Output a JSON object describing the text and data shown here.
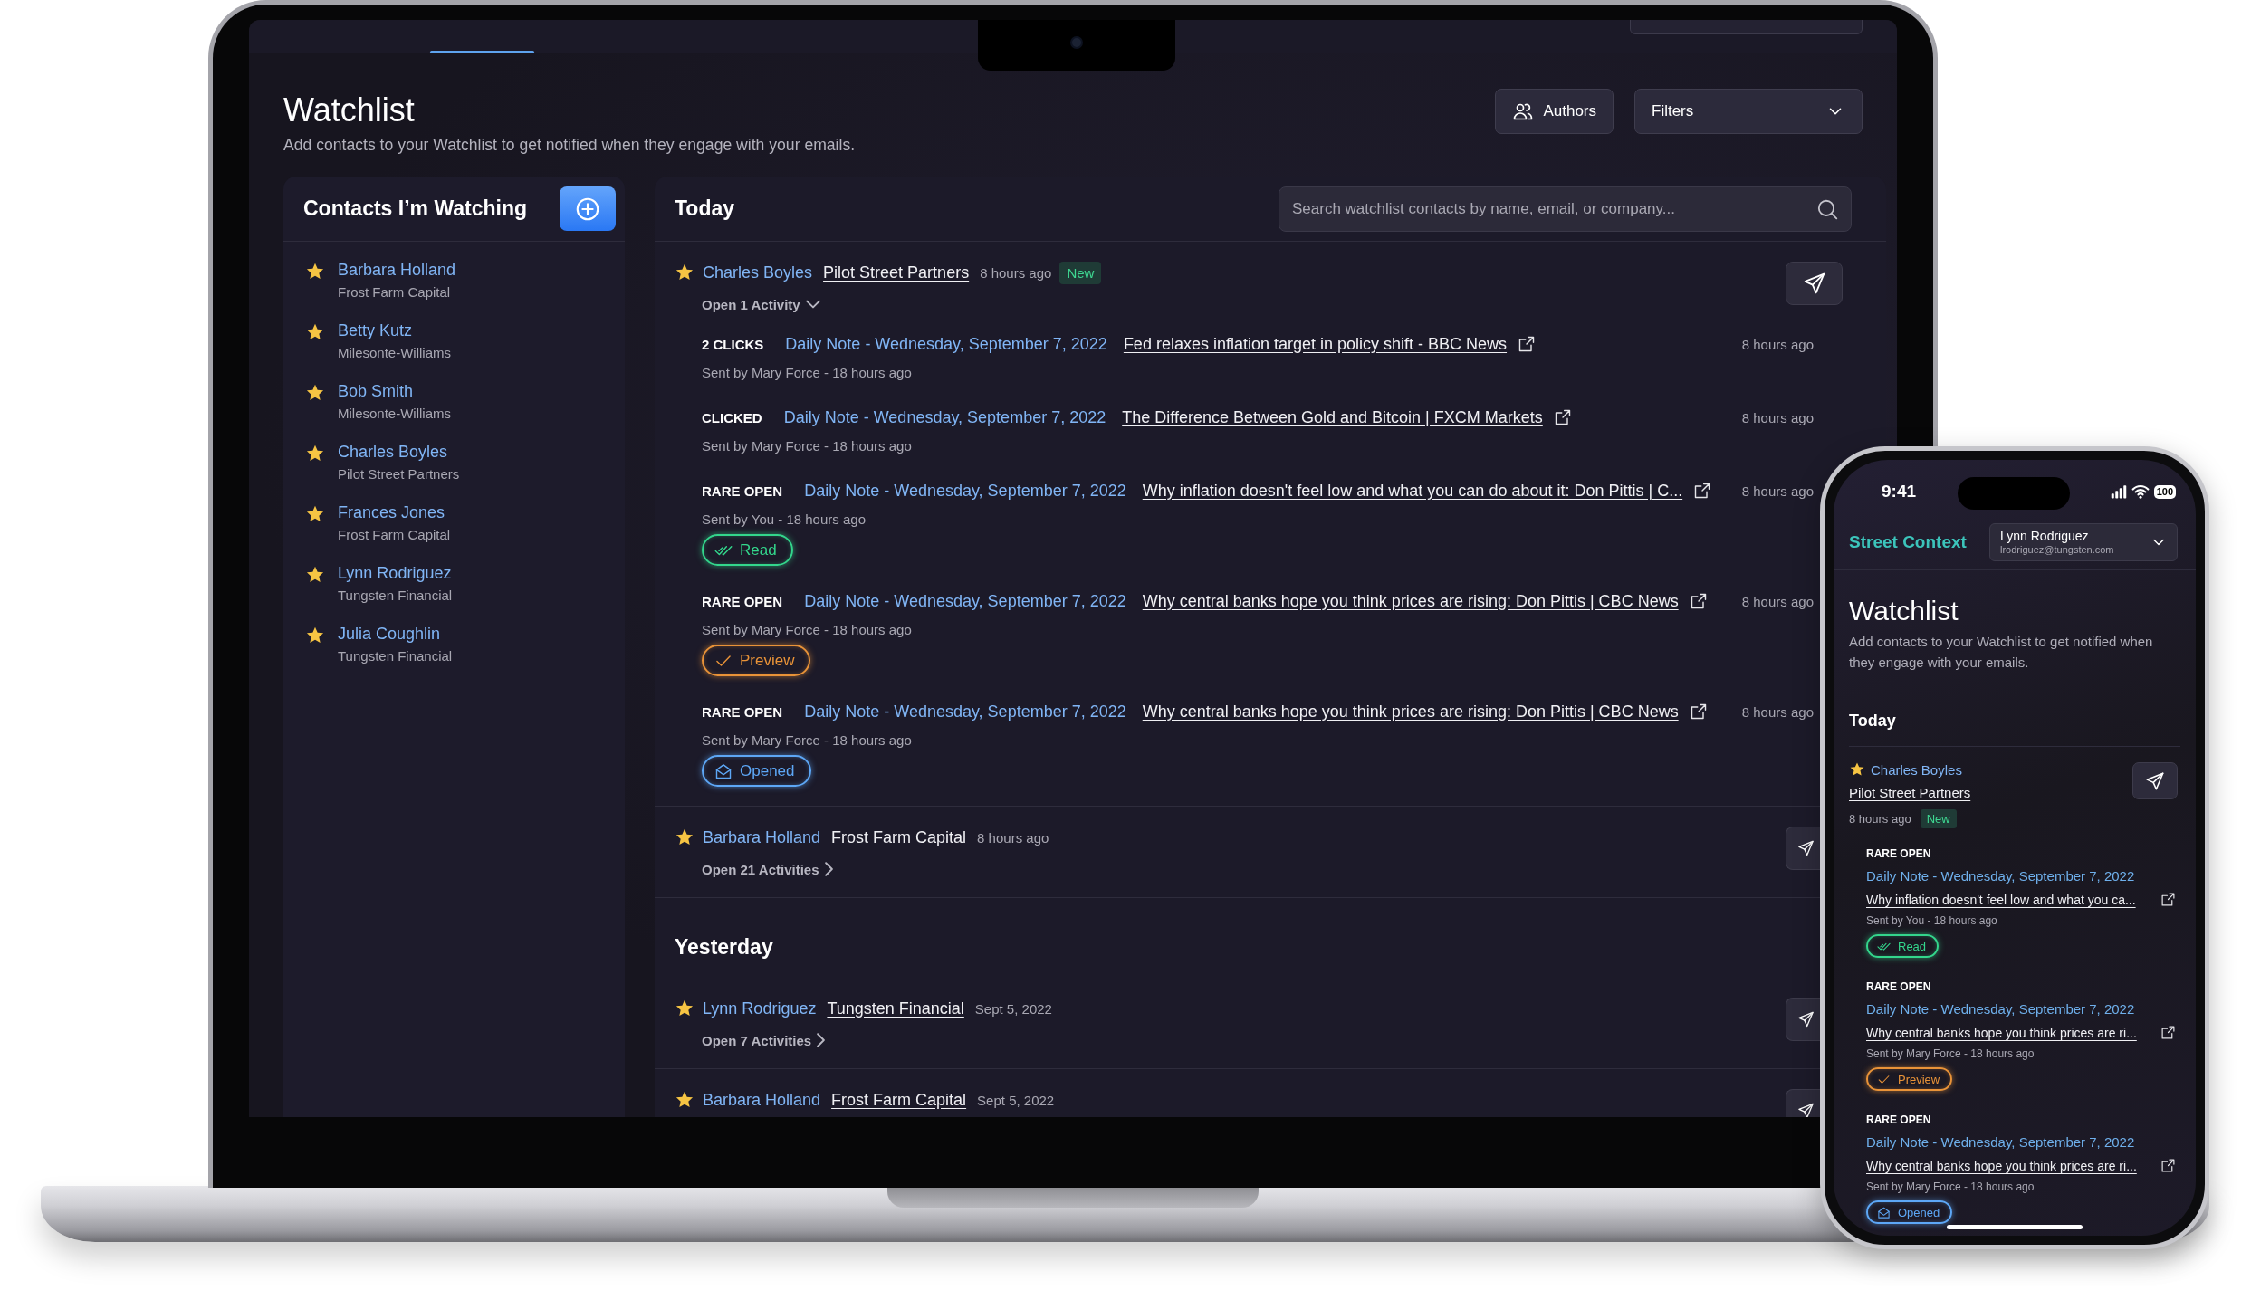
{
  "laptop": {
    "page": {
      "title": "Watchlist",
      "subtitle": "Add contacts to your Watchlist to get notified when they engage with your emails."
    },
    "actions": {
      "authors": "Authors",
      "filters": "Filters"
    },
    "sidebar": {
      "title": "Contacts I’m Watching",
      "contacts": [
        {
          "name": "Barbara Holland",
          "company": "Frost Farm Capital"
        },
        {
          "name": "Betty Kutz",
          "company": "Milesonte-Williams"
        },
        {
          "name": "Bob Smith",
          "company": "Milesonte-Williams"
        },
        {
          "name": "Charles Boyles",
          "company": "Pilot Street Partners"
        },
        {
          "name": "Frances Jones",
          "company": "Frost Farm Capital"
        },
        {
          "name": "Lynn Rodriguez",
          "company": "Tungsten Financial"
        },
        {
          "name": "Julia Coughlin",
          "company": "Tungsten Financial"
        }
      ]
    },
    "feed": {
      "search": {
        "placeholder": "Search watchlist contacts by name, email, or company..."
      },
      "sections": [
        {
          "title": "Today",
          "entries": [
            {
              "name": "Charles Boyles",
              "company": "Pilot Street Partners",
              "time": "8 hours ago",
              "badge": "New",
              "toggle": "Open 1 Activity",
              "expanded": true,
              "activities": [
                {
                  "type": "2 CLICKS",
                  "email": "Daily Note - Wednesday, September 7, 2022",
                  "link": "Fed relaxes inflation target in policy shift - BBC News",
                  "sent": "Sent by Mary Force - 18 hours ago",
                  "time": "8 hours ago"
                },
                {
                  "type": "CLICKED",
                  "email": "Daily Note - Wednesday, September 7, 2022",
                  "link": "The Difference Between Gold and Bitcoin | FXCM Markets",
                  "sent": "Sent by Mary Force - 18 hours ago",
                  "time": "8 hours ago"
                },
                {
                  "type": "RARE OPEN",
                  "email": "Daily Note - Wednesday, September 7, 2022",
                  "link": "Why inflation doesn't feel low and what you can do about it: Don Pittis | C...",
                  "sent": "Sent by You - 18 hours ago",
                  "time": "8 hours ago",
                  "status": {
                    "kind": "read",
                    "label": "Read"
                  }
                },
                {
                  "type": "RARE OPEN",
                  "email": "Daily Note - Wednesday, September 7, 2022",
                  "link": "Why central banks hope you think prices are rising: Don Pittis | CBC News",
                  "sent": "Sent by Mary Force - 18 hours ago",
                  "time": "8 hours ago",
                  "status": {
                    "kind": "preview",
                    "label": "Preview"
                  }
                },
                {
                  "type": "RARE OPEN",
                  "email": "Daily Note - Wednesday, September 7, 2022",
                  "link": "Why central banks hope you think prices are rising: Don Pittis | CBC News",
                  "sent": "Sent by Mary Force - 18 hours ago",
                  "time": "8 hours ago",
                  "status": {
                    "kind": "opened",
                    "label": "Opened"
                  }
                }
              ]
            },
            {
              "name": "Barbara Holland",
              "company": "Frost Farm Capital",
              "time": "8 hours ago",
              "toggle": "Open 21 Activities",
              "expanded": false
            }
          ]
        },
        {
          "title": "Yesterday",
          "entries": [
            {
              "name": "Lynn Rodriguez",
              "company": "Tungsten Financial",
              "time": "Sept 5, 2022",
              "toggle": "Open 7 Activities",
              "expanded": false
            },
            {
              "name": "Barbara Holland",
              "company": "Frost Farm Capital",
              "time": "Sept 5, 2022"
            }
          ]
        }
      ]
    }
  },
  "phone": {
    "status_bar": {
      "time": "9:41",
      "battery": "100"
    },
    "brand": "Street Context",
    "account": {
      "name": "Lynn Rodriguez",
      "email": "lrodriguez@tungsten.com"
    },
    "page": {
      "title": "Watchlist",
      "subtitle": "Add contacts to your Watchlist to get notified when they engage with your emails."
    },
    "section": "Today",
    "entry": {
      "name": "Charles Boyles",
      "company": "Pilot Street Partners",
      "time": "8 hours ago",
      "badge": "New",
      "activities": [
        {
          "type": "RARE OPEN",
          "email": "Daily Note - Wednesday, September 7, 2022",
          "link": "Why inflation doesn't feel low and what you ca...",
          "sent": "Sent by You - 18 hours ago",
          "status": {
            "kind": "read",
            "label": "Read"
          }
        },
        {
          "type": "RARE OPEN",
          "email": "Daily Note - Wednesday, September 7, 2022",
          "link": "Why central banks hope you think prices are ri...",
          "sent": "Sent by Mary Force - 18 hours ago",
          "status": {
            "kind": "preview",
            "label": "Preview"
          }
        },
        {
          "type": "RARE OPEN",
          "email": "Daily Note - Wednesday, September 7, 2022",
          "link": "Why central banks hope you think prices are ri...",
          "sent": "Sent by Mary Force - 18 hours ago",
          "status": {
            "kind": "opened",
            "label": "Opened"
          }
        }
      ]
    }
  }
}
